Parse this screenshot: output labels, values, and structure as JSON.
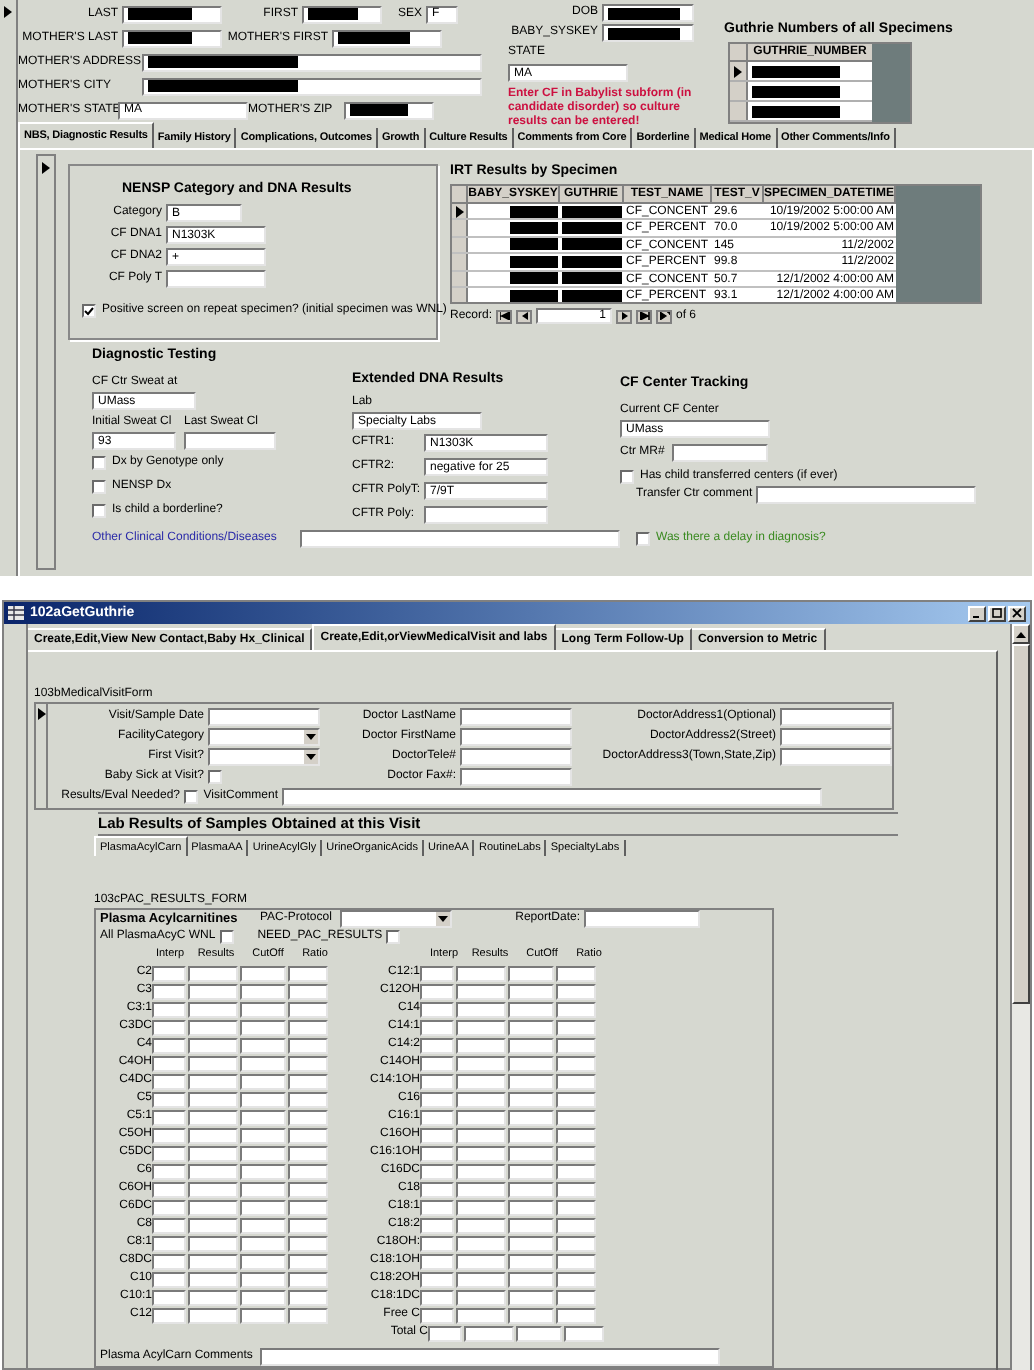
{
  "patient": {
    "rows": [
      [
        {
          "label": "LAST",
          "redacted": true
        },
        {
          "label": "FIRST",
          "redacted": true
        },
        {
          "label": "SEX",
          "value": "F"
        }
      ],
      [
        {
          "label": "MOTHER'S LAST",
          "redacted": true
        },
        {
          "label": "MOTHER'S FIRST",
          "redacted": true
        }
      ],
      [
        {
          "label": "MOTHER'S ADDRESS",
          "redacted": true
        }
      ],
      [
        {
          "label": "MOTHER'S CITY",
          "redacted": true
        }
      ],
      [
        {
          "label": "MOTHER'S STATE",
          "value": "MA"
        },
        {
          "label": "MOTHER'S ZIP",
          "redacted": true
        }
      ]
    ],
    "side_fields": [
      {
        "label": "DOB",
        "redacted": true
      },
      {
        "label": "BABY_SYSKEY",
        "redacted": true
      }
    ],
    "state": {
      "label": "STATE",
      "value": "MA"
    },
    "warning": "Enter CF in Babylist subform (in candidate disorder) so culture results can be entered!"
  },
  "guthrie": {
    "title": "Guthrie Numbers of all Specimens",
    "column": "GUTHRIE_NUMBER",
    "rows": [
      {
        "current": true,
        "redacted": true
      },
      {
        "current": false,
        "redacted": true
      },
      {
        "current": false,
        "redacted": true
      }
    ]
  },
  "tabs": [
    {
      "label": "NBS, Diagnostic Results",
      "selected": true
    },
    {
      "label": "Family History",
      "selected": false
    },
    {
      "label": "Complications, Outcomes",
      "selected": false
    },
    {
      "label": "Growth",
      "selected": false
    },
    {
      "label": "Culture Results",
      "selected": false
    },
    {
      "label": "Comments from Core",
      "selected": false
    },
    {
      "label": "Borderline",
      "selected": false
    },
    {
      "label": "Medical Home",
      "selected": false
    },
    {
      "label": "Other Comments/Info",
      "selected": false
    }
  ],
  "nensp": {
    "title": "NENSP Category and DNA Results",
    "fields": [
      {
        "label": "Category",
        "value": "B"
      },
      {
        "label": "CF DNA1",
        "value": "N1303K"
      },
      {
        "label": "CF DNA2",
        "value": "+"
      },
      {
        "label": "CF Poly T"
      }
    ],
    "checkbox": {
      "label": "Positive screen on repeat specimen? (initial specimen was WNL)",
      "checked": true
    }
  },
  "irt": {
    "title": "IRT Results by Specimen",
    "columns": [
      "BABY_SYSKEY",
      "GUTHRIE",
      "TEST_NAME",
      "TEST_V",
      "SPECIMEN_DATETIME"
    ],
    "rows": [
      {
        "current": true,
        "redacted": true,
        "test_name": "CF_CONCENT",
        "test_value": "29.6",
        "specimen_datetime": "10/19/2002 5:00:00 AM"
      },
      {
        "current": false,
        "redacted": true,
        "test_name": "CF_PERCENT",
        "test_value": "70.0",
        "specimen_datetime": "10/19/2002 5:00:00 AM"
      },
      {
        "current": false,
        "redacted": true,
        "test_name": "CF_CONCENT",
        "test_value": "145",
        "specimen_datetime": "11/2/2002"
      },
      {
        "current": false,
        "redacted": true,
        "test_name": "CF_PERCENT",
        "test_value": "99.8",
        "specimen_datetime": "11/2/2002"
      },
      {
        "current": false,
        "redacted": true,
        "test_name": "CF_CONCENT",
        "test_value": "50.7",
        "specimen_datetime": "12/1/2002 4:00:00 AM"
      },
      {
        "current": false,
        "redacted": true,
        "test_name": "CF_PERCENT",
        "test_value": "93.1",
        "specimen_datetime": "12/1/2002 4:00:00 AM"
      }
    ],
    "navigator": {
      "label": "Record:",
      "current": "1",
      "total": "of 6"
    }
  },
  "diagnostic_testing": {
    "title": "Diagnostic Testing",
    "sweat_at": {
      "label": "CF Ctr Sweat at",
      "value": "UMass"
    },
    "initial_sweat": {
      "label": "Initial Sweat Cl",
      "value": "93"
    },
    "last_sweat": {
      "label": "Last Sweat Cl"
    },
    "checkboxes": [
      {
        "label": "Dx by Genotype only",
        "checked": false
      },
      {
        "label": "NENSP Dx",
        "checked": false
      },
      {
        "label": "Is child a borderline?",
        "checked": false
      }
    ]
  },
  "extended_dna": {
    "title": "Extended DNA Results",
    "lab": {
      "label": "Lab",
      "value": "Specialty Labs"
    },
    "fields": [
      {
        "label": "CFTR1:",
        "value": "N1303K"
      },
      {
        "label": "CFTR2:",
        "value": "negative for 25"
      },
      {
        "label": "CFTR PolyT:",
        "value": "7/9T"
      },
      {
        "label": "CFTR Poly:"
      }
    ]
  },
  "cf_center": {
    "title": "CF Center Tracking",
    "current_center": {
      "label": "Current CF Center",
      "value": "UMass"
    },
    "mr": {
      "label": "Ctr MR#"
    },
    "transferred": {
      "label": "Has child transferred centers (if ever)",
      "checked": false
    },
    "transfer_comment": {
      "label": "Transfer Ctr comment"
    }
  },
  "other_conditions": {
    "label": "Other Clinical Conditions/Diseases"
  },
  "delay": {
    "label": "Was there a delay in diagnosis?",
    "checked": false
  },
  "window2": {
    "title": "102aGetGuthrie",
    "tabs": [
      {
        "label": "Create,Edit,View New Contact,Baby Hx_Clinical",
        "selected": false
      },
      {
        "label": "Create,Edit,orViewMedicalVisit and labs",
        "selected": true
      },
      {
        "label": "Long Term Follow-Up",
        "selected": false
      },
      {
        "label": "Conversion to Metric",
        "selected": false
      }
    ],
    "subform_label": "103bMedicalVisitForm",
    "visit_columns": [
      [
        {
          "label": "Visit/Sample Date",
          "kind": "text"
        },
        {
          "label": "FacilityCategory",
          "kind": "combo"
        },
        {
          "label": "First Visit?",
          "kind": "combo"
        },
        {
          "label": "Baby Sick at Visit?",
          "kind": "checkbox",
          "checked": false
        }
      ],
      [
        {
          "label": "Doctor LastName",
          "kind": "text"
        },
        {
          "label": "Doctor FirstName",
          "kind": "text"
        },
        {
          "label": "DoctorTele#",
          "kind": "text"
        },
        {
          "label": "Doctor Fax#:",
          "kind": "text"
        }
      ],
      [
        {
          "label": "DoctorAddress1(Optional)",
          "kind": "text"
        },
        {
          "label": "DoctorAddress2(Street)",
          "kind": "text"
        },
        {
          "label": "DoctorAddress3(Town,State,Zip)",
          "kind": "text"
        }
      ]
    ],
    "results_needed": {
      "label": "Results/Eval Needed?",
      "checked": false
    },
    "visit_comment": {
      "label": "VisitComment"
    },
    "lab_heading": "Lab Results of Samples Obtained at this Visit",
    "lab_tabs": [
      {
        "label": "PlasmaAcylCarn",
        "selected": true
      },
      {
        "label": "PlasmaAA",
        "selected": false
      },
      {
        "label": "UrineAcylGly",
        "selected": false
      },
      {
        "label": "UrineOrganicAcids",
        "selected": false
      },
      {
        "label": "UrineAA",
        "selected": false
      },
      {
        "label": "RoutineLabs",
        "selected": false
      },
      {
        "label": "SpecialtyLabs",
        "selected": false
      }
    ],
    "pac_label": "103cPAC_RESULTS_FORM",
    "pac": {
      "title": "Plasma Acylcarnitines",
      "protocol": {
        "label": "PAC-Protocol"
      },
      "report_date": {
        "label": "ReportDate:"
      },
      "all_wnl": {
        "label": "All PlasmaAcyC WNL",
        "checked": false
      },
      "need_results": {
        "label": "NEED_PAC_RESULTS",
        "checked": false
      },
      "columns_left": [
        "Interp",
        "Results",
        "CutOff",
        "Ratio"
      ],
      "columns_right": [
        "Interp",
        "Results",
        "CutOff",
        "Ratio"
      ],
      "left": [
        "C2",
        "C3",
        "C3:1",
        "C3DC",
        "C4",
        "C4OH",
        "C4DC",
        "C5",
        "C5:1",
        "C5OH",
        "C5DC",
        "C6",
        "C6OH",
        "C6DC",
        "C8",
        "C8:1",
        "C8DC",
        "C10",
        "C10:1",
        "C12"
      ],
      "right": [
        "C12:1",
        "C12OH",
        "C14",
        "C14:1",
        "C14:2",
        "C14OH",
        "C14:1OH",
        "C16",
        "C16:1",
        "C16OH",
        "C16:1OH",
        "C16DC",
        "C18",
        "C18:1",
        "C18:2",
        "C18OH:",
        "C18:1OH",
        "C18:2OH",
        "C18:1DC",
        "Free C",
        "Total C"
      ],
      "comments": {
        "label": "Plasma AcylCarn Comments"
      }
    }
  }
}
